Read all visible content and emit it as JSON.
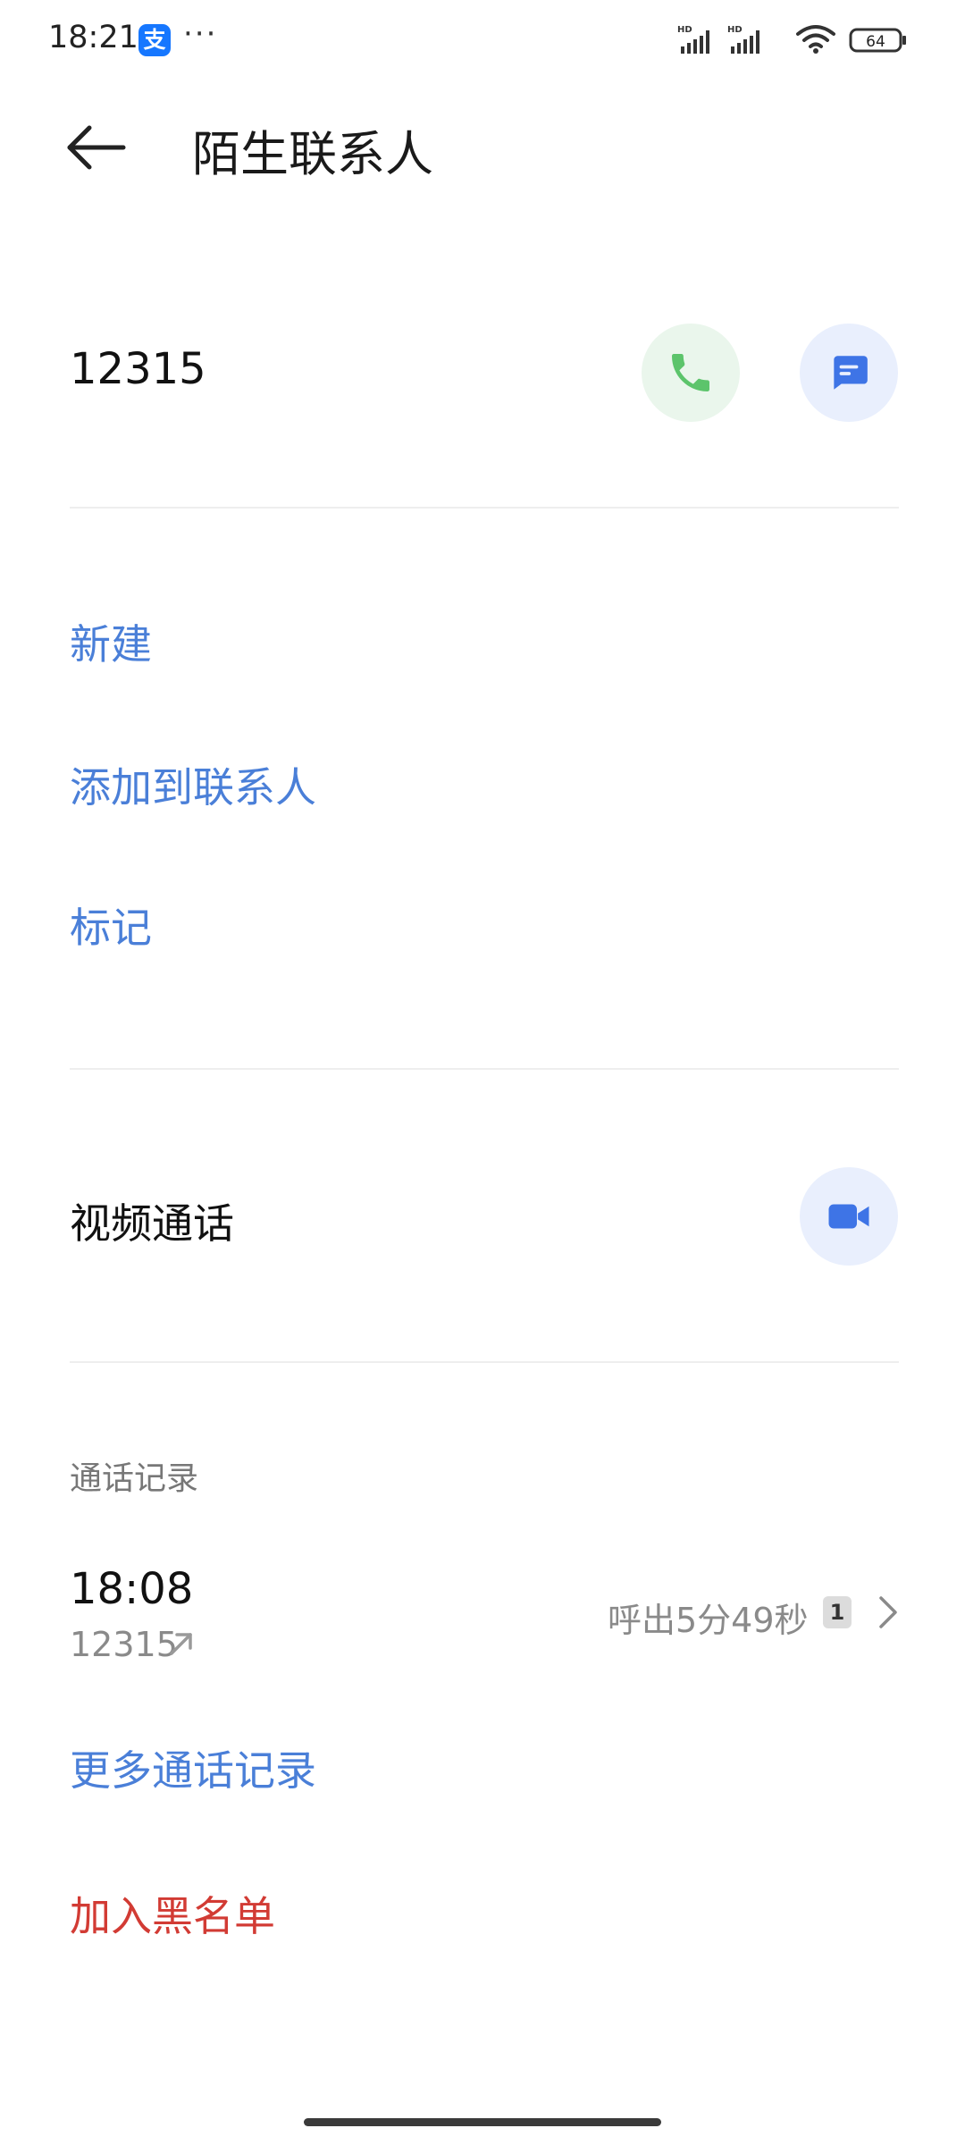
{
  "status_bar": {
    "time": "18:21",
    "app_badge": "支",
    "more_dots": "···",
    "signal_1_label": "HD",
    "signal_2_label": "HD",
    "battery": "64"
  },
  "header": {
    "title": "陌生联系人"
  },
  "contact": {
    "number": "12315"
  },
  "actions": {
    "new": "新建",
    "add_to_contacts": "添加到联系人",
    "mark": "标记"
  },
  "video_call": {
    "label": "视频通话"
  },
  "call_log": {
    "section_title": "通话记录",
    "entries": [
      {
        "time": "18:08",
        "number": "12315",
        "detail": "呼出5分49秒",
        "sim": "1"
      }
    ],
    "more": "更多通话记录"
  },
  "blacklist": {
    "label": "加入黑名单"
  },
  "colors": {
    "accent_blue": "#4a7fd8",
    "danger_red": "#d23b34",
    "call_green": "#5cc46b",
    "icon_blue": "#3e74e6"
  }
}
